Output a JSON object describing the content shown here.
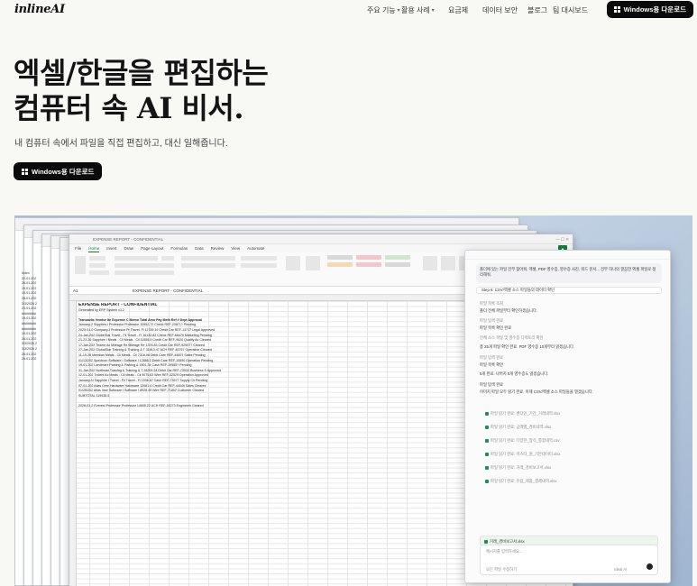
{
  "nav": {
    "logo": "inlineAI",
    "links": [
      {
        "label": "주요 기능",
        "dropdown": true,
        "width": 38
      },
      {
        "label": "활용 사례",
        "dropdown": true,
        "width": 52
      },
      {
        "label": "요금제",
        "dropdown": false,
        "width": 38
      },
      {
        "label": "데이터 보안",
        "dropdown": false,
        "width": 50
      },
      {
        "label": "블로그",
        "dropdown": false,
        "width": 28
      },
      {
        "label": "팀 대시보드",
        "dropdown": false,
        "width": 50
      }
    ],
    "cta": "Windows용 다운로드"
  },
  "hero": {
    "title_line1": "엑셀/한글을 편집하는",
    "title_line2": "컴퓨터 속 AI 비서.",
    "subtitle": "내 컴퓨터 속에서 파일을 직접 편집하고, 대신 일해줍니다.",
    "cta": "Windows용 다운로드"
  },
  "excel": {
    "window_title": "EXPENSE REPORT - CONFIDENTIAL",
    "tabs": [
      "File",
      "Home",
      "Insert",
      "Draw",
      "Page Layout",
      "Formulas",
      "Data",
      "Review",
      "View",
      "Automate"
    ],
    "cell_ref": "A1",
    "formula": "EXPENSE REPORT - CONFIDENTIAL",
    "sheet_title": "EXPENSE REPORT - CONFIDENTIAL",
    "sheet_subtitle": "Generated by ERP System v3.2",
    "header_row": "Transactic Vendor Ite Expense C Memo      Total Amo Pay Meth Ref #      Dept      Approval",
    "rows": [
      "January-2 Supplies-I Professior Professior   10552.72 Check     REF-23871?          Pending",
      "2025-01-0 Company-I Professior Pr Travel- Fl  11759.19 Credit Car REF-13717 Legal   Approved",
      "24-Jan-202 Globe/Dar Travel - Fli Travel - Fl  16132.82 Check   REF-68479 Marketing Pending",
      "21-23-26 Sapphire I Meals - Cli Meals - Cli 11555.5 Credit Car REF-9620 Quality As Cleared",
      "17-Jan-202 Trident Ac Mileage Re Mileage Re   1378.83 Credit Car REF-92907?         Cleared",
      "27-Jan-202 Global/Dar Training & Training & T 31813.47 ACH     REF-45767 Operation Cleared",
      "11-19-28 Meridian Meals - Cli Meals - Cli     7316.06 Debit Care REF-44897 Sales  Pending",
      "01/13/202 Spectrum Software I Software I     12888.2 Debit Care REF-15590 Operation Pending",
      "19-01-202 Landmark Parking & Parking &      3901.34 Cash    REF-19585?            Pending",
      "31-Jan-202 Northstar Training & Training & T 28209.34 Debit Car REF-73932 Business S Approved",
      "12-01-202 Trident Ac Meals - Cli Meals - Cli  9075.63 Wire    REF-32529 Operation Approved",
      "January-N Sapphire I Travel - Fli Travel - Fl  1936.67 Cash   REF-73577 Supply Ch Pending",
      "07-01-202 Atlas Ome Hardware Hardware        12081.4 Credit Car REF-44049 Sales    Cleared",
      "01/26/202 Atlas Instr Software I Software I   8928.49 Wire    REF-71802 Customer Cleared",
      "SUBTOTAL                                      119938.5",
      "",
      "2026-01-2 Everest Professior Professior      14605.22 ACH     REF-16273 Engineerir Cleared"
    ],
    "left_ids": [
      "Index",
      "22-01-202",
      "28-01-202",
      "19-01-202",
      "19-01-202",
      "28-01-202",
      "3/3/2026 2",
      "23-01-202",
      "########",
      "19-01-202",
      "########",
      "########",
      "19-01-202",
      "28-01-202",
      "3/3/2026 2",
      "3/3/2026 2",
      "28-01-202",
      "28-01-202"
    ]
  },
  "ai_panel": {
    "prompt": "폴더에 있는 파일 전부 찾아줘. 엑셀, PDF 영수증, 영수증 사진, 워드 문서... 전부 하나의 깔끔한 엑셀 파일로 정리해줘.",
    "step": "Step 6: CSV/엑셀 소스 파일들의 데이터 확인",
    "lines": [
      "파일 목록 조회",
      "폴더 전체 파일부터 확인하겠습니다.",
      "파일 탐색 완료",
      "파일 목록 확인 완료",
      "전체 소스 파일 및 영수증 디렉토리 확인",
      "총 25개 파일 확인 완료. PDF 영수증 10개부터 읽겠습니다.",
      "파일 탐색 완료",
      "파일 목록 확인",
      "5개 완료. 나머지 5개 영수증도 읽겠습니다.",
      "파일 탐색 완료",
      "이미지 파일 모두 읽기 완료. 이제 CSV/엑셀 소스 파일들을 열겠습니다."
    ],
    "files": [
      "파일 읽기 완료: 벤더인_기간_거래내역.xlsx",
      "파일 읽기 완료: 금액별_경비내역.xlsx",
      "파일 읽기 완료: 다양한_형식_통합내역.csv",
      "파일 읽기 완료: 마스터_원_기본데이터.xlsx",
      "파일 읽기 완료: 거래_경비보고서.xlsx",
      "파일 읽기 완료: 유럽_제품_결제내역.xlsx"
    ],
    "attachment": "거래_경비보고서.xlsx",
    "input_placeholder": "메시지를 입력하세요...",
    "input_mode": "모든 파일 수정하기",
    "model": "Ideal AI"
  }
}
